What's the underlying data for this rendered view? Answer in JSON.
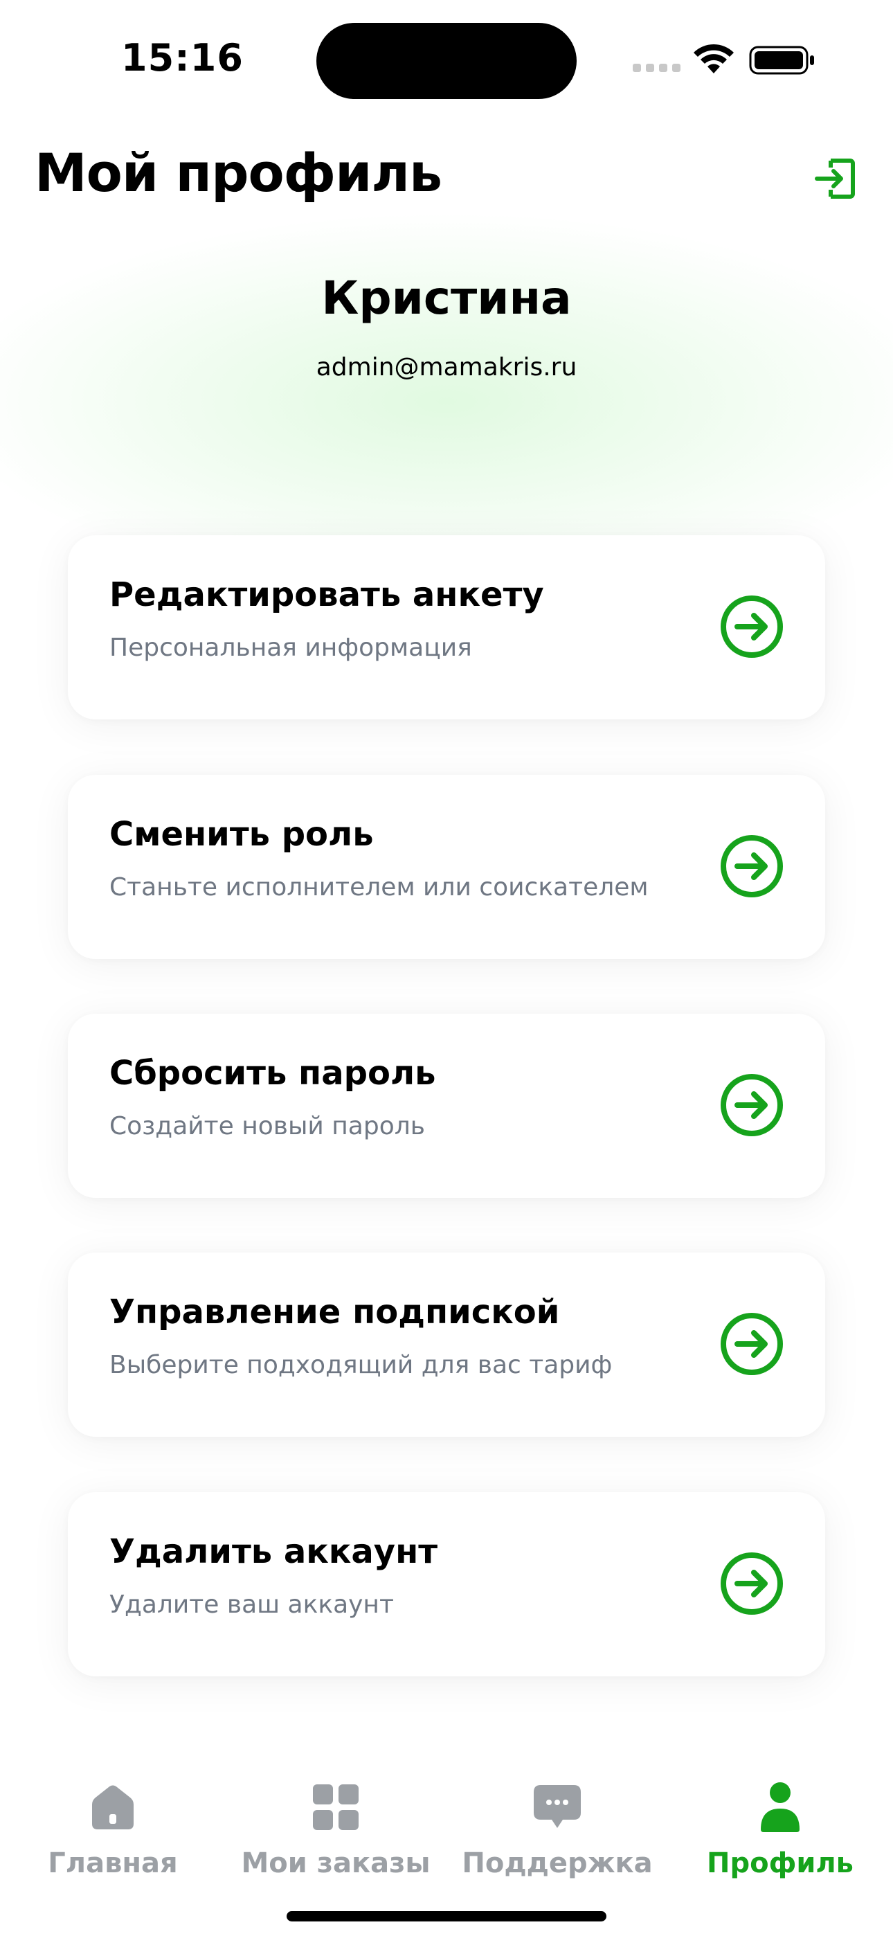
{
  "status_bar": {
    "time": "15:16"
  },
  "header": {
    "title": "Мой профиль",
    "logout_icon": "logout-icon"
  },
  "profile": {
    "name": "Кристина",
    "email": "admin@mamakris.ru"
  },
  "menu": [
    {
      "title": "Редактировать анкету",
      "subtitle": "Персональная информация",
      "icon": "arrow-right-circle-icon"
    },
    {
      "title": "Сменить роль",
      "subtitle": "Станьте исполнителем или соискателем",
      "icon": "arrow-right-circle-icon"
    },
    {
      "title": "Сбросить пароль",
      "subtitle": "Создайте новый пароль",
      "icon": "arrow-right-circle-icon"
    },
    {
      "title": "Управление подпиской",
      "subtitle": "Выберите подходящий для вас тариф",
      "icon": "arrow-right-circle-icon"
    },
    {
      "title": "Удалить аккаунт",
      "subtitle": "Удалите ваш аккаунт",
      "icon": "arrow-right-circle-icon"
    }
  ],
  "tab_bar": {
    "items": [
      {
        "label": "Главная",
        "icon": "home-icon",
        "active": false
      },
      {
        "label": "Мои заказы",
        "icon": "grid-icon",
        "active": false
      },
      {
        "label": "Поддержка",
        "icon": "chat-bubble-icon",
        "active": false
      },
      {
        "label": "Профиль",
        "icon": "user-icon",
        "active": true
      }
    ]
  },
  "colors": {
    "accent": "#16a31c",
    "inactive": "#9ca0a5",
    "subtitle": "#6f7783",
    "glow": "#d8f7d8"
  }
}
